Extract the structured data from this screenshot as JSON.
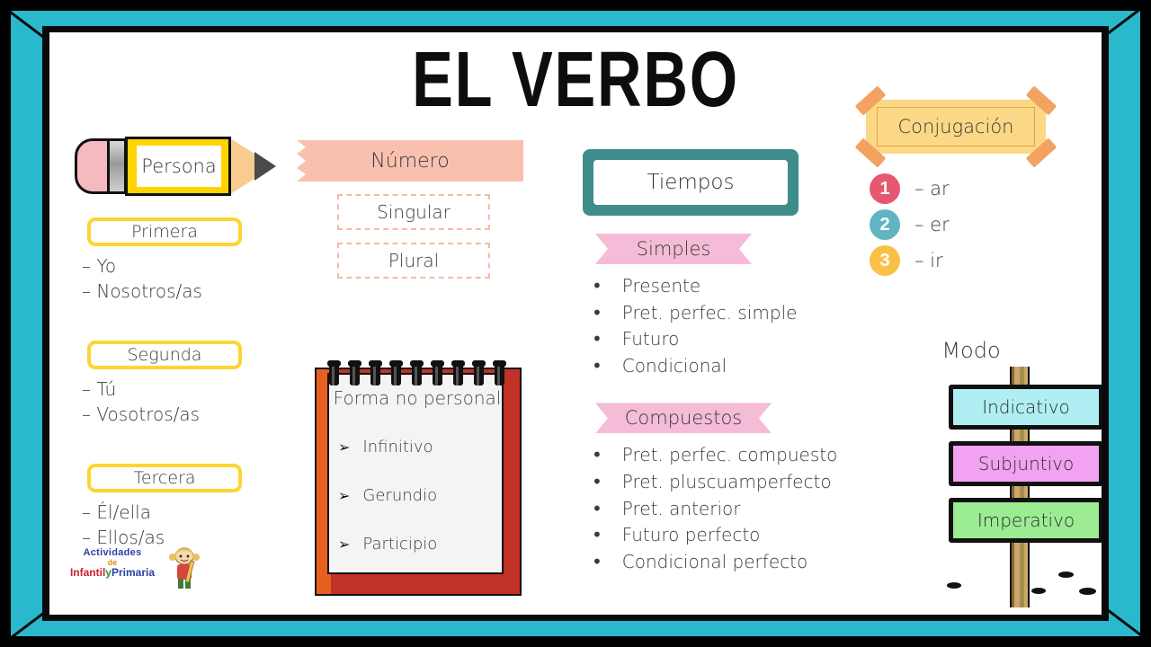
{
  "page": {
    "title": "EL VERBO",
    "frame_color": "#29B8CC",
    "background": "#FFFFFF"
  },
  "persona": {
    "pencil_label": "Persona",
    "groups": [
      {
        "heading": "Primera",
        "items": [
          "– Yo",
          "– Nosotros/as"
        ]
      },
      {
        "heading": "Segunda",
        "items": [
          "– Tú",
          "– Vosotros/as"
        ]
      },
      {
        "heading": "Tercera",
        "items": [
          "– Él/ella",
          "– Ellos/as"
        ]
      }
    ],
    "box_border_color": "#FCD533"
  },
  "numero": {
    "banner": "Número",
    "banner_color": "#FAC0AF",
    "options": [
      "Singular",
      "Plural"
    ]
  },
  "forma_no_personal": {
    "title": "Forma no personal",
    "items": [
      "Infinitivo",
      "Gerundio",
      "Participio"
    ],
    "bullet_glyph": "➢",
    "notepad_color": "#C03226",
    "notepad_spine_color": "#E8601F"
  },
  "tiempos": {
    "plate_label": "Tiempos",
    "plate_color": "#3E8C8C",
    "banner_color": "#F4BCD6",
    "sections": [
      {
        "banner": "Simples",
        "items": [
          "Presente",
          "Pret. perfec. simple",
          "Futuro",
          "Condicional"
        ]
      },
      {
        "banner": "Compuestos",
        "items": [
          "Pret. perfec. compuesto",
          "Pret. pluscuamperfecto",
          "Pret. anterior",
          "Futuro perfecto",
          "Condicional perfecto"
        ]
      }
    ],
    "bullet_glyph": "•"
  },
  "conjugacion": {
    "title": "Conjugación",
    "card_color": "#FBD885",
    "tape_color": "#F3A261",
    "rows": [
      {
        "number": "1",
        "ending": "– ar",
        "color": "#E8566F"
      },
      {
        "number": "2",
        "ending": "– er",
        "color": "#62B4C0"
      },
      {
        "number": "3",
        "ending": "– ir",
        "color": "#F9C04A"
      }
    ]
  },
  "modo": {
    "title": "Modo",
    "signs": [
      {
        "label": "Indicativo",
        "color": "#AFEFF3"
      },
      {
        "label": "Subjuntivo",
        "color": "#F2A2F0"
      },
      {
        "label": "Imperativo",
        "color": "#9CEC94"
      }
    ],
    "post_color": "#C9A86A"
  },
  "logo": {
    "line1": "Actividades",
    "line2": "de",
    "line3_a": "Infantil",
    "line3_b": "y",
    "line3_c": "Primaria"
  }
}
